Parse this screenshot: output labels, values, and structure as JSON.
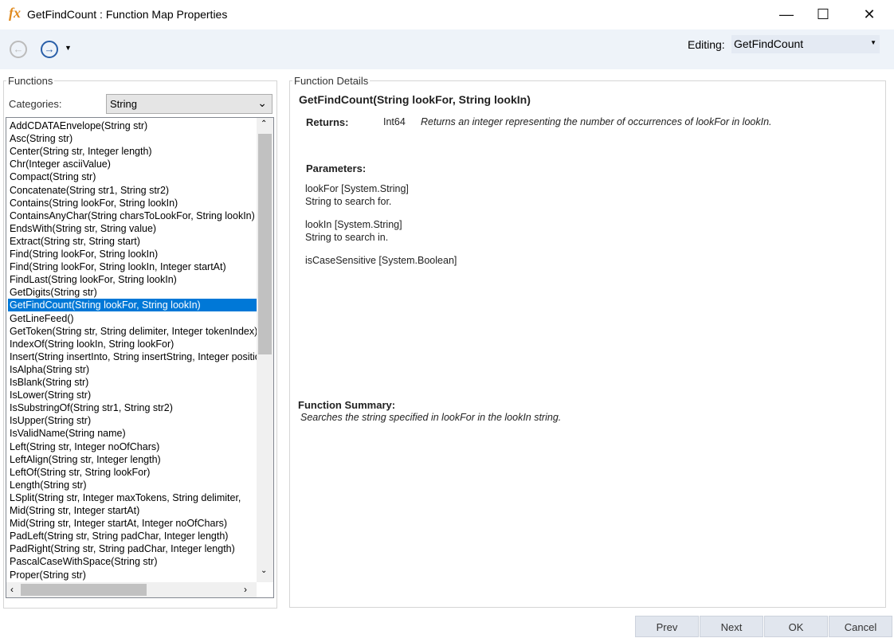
{
  "window": {
    "title": "GetFindCount : Function Map Properties",
    "icon": "fx-icon",
    "controls": [
      "minimize",
      "maximize",
      "close"
    ]
  },
  "toolbar": {
    "editing_label": "Editing:",
    "editing_value": "GetFindCount"
  },
  "functions": {
    "group_label": "Functions",
    "categories_label": "Categories:",
    "category_value": "String",
    "selected_index": 14,
    "items": [
      "AddCDATAEnvelope(String str)",
      "Asc(String str)",
      "Center(String str, Integer length)",
      "Chr(Integer asciiValue)",
      "Compact(String str)",
      "Concatenate(String str1, String str2)",
      "Contains(String lookFor, String lookIn)",
      "ContainsAnyChar(String charsToLookFor, String lookIn)",
      "EndsWith(String str, String value)",
      "Extract(String str, String start)",
      "Find(String lookFor, String lookIn)",
      "Find(String lookFor, String lookIn, Integer startAt)",
      "FindLast(String lookFor, String lookIn)",
      "GetDigits(String str)",
      "GetFindCount(String lookFor, String lookIn)",
      "GetLineFeed()",
      "GetToken(String str, String delimiter, Integer tokenIndex)",
      "IndexOf(String lookIn, String lookFor)",
      "Insert(String insertInto, String insertString, Integer position)",
      "IsAlpha(String str)",
      "IsBlank(String str)",
      "IsLower(String str)",
      "IsSubstringOf(String str1, String str2)",
      "IsUpper(String str)",
      "IsValidName(String name)",
      "Left(String str, Integer noOfChars)",
      "LeftAlign(String str, Integer length)",
      "LeftOf(String str, String lookFor)",
      "Length(String str)",
      "LSplit(String str, Integer maxTokens, String delimiter, ",
      "Mid(String str, Integer startAt)",
      "Mid(String str, Integer startAt, Integer noOfChars)",
      "PadLeft(String str, String padChar, Integer length)",
      "PadRight(String str, String padChar, Integer length)",
      "PascalCaseWithSpace(String str)",
      "Proper(String str)"
    ]
  },
  "details": {
    "group_label": "Function Details",
    "signature": "GetFindCount(String lookFor, String lookIn)",
    "returns_label": "Returns:",
    "returns_type": "Int64",
    "returns_desc": "Returns an integer representing the number of occurrences of lookFor in lookIn.",
    "parameters_label": "Parameters:",
    "parameters": [
      {
        "name": "lookFor [System.String]",
        "desc": "String to search for."
      },
      {
        "name": "lookIn [System.String]",
        "desc": "String to search in."
      },
      {
        "name": "isCaseSensitive [System.Boolean]",
        "desc": ""
      }
    ],
    "summary_label": "Function Summary:",
    "summary": "Searches the string specified in lookFor in the lookIn string."
  },
  "buttons": {
    "prev": "Prev",
    "next": "Next",
    "ok": "OK",
    "cancel": "Cancel"
  }
}
